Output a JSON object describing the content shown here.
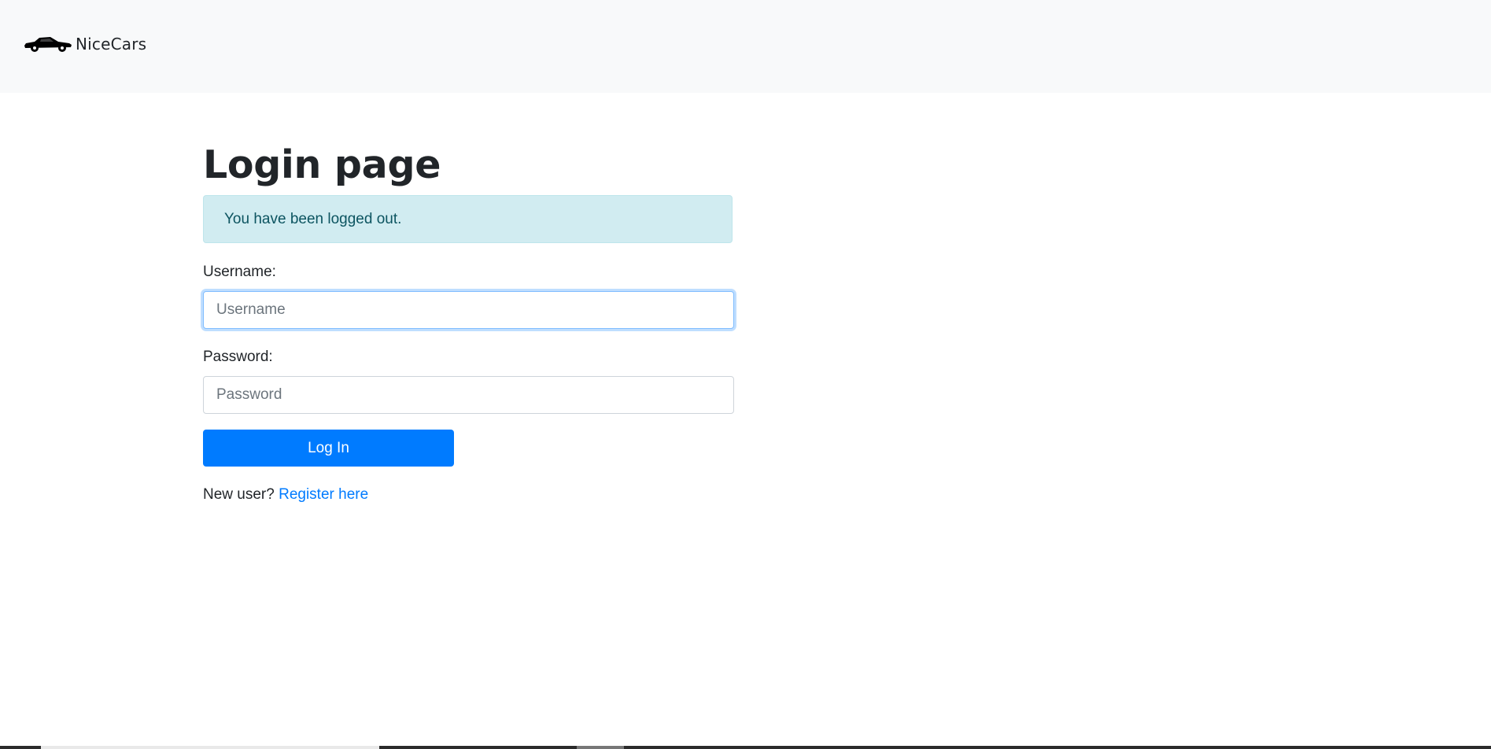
{
  "navbar": {
    "brand_name": "NiceCars",
    "brand_icon": "car-icon"
  },
  "main": {
    "title": "Login page",
    "alert": {
      "message": "You have been logged out.",
      "color": "#d1ecf1"
    },
    "form": {
      "username_label": "Username:",
      "username_placeholder": "Username",
      "username_value": "",
      "password_label": "Password:",
      "password_placeholder": "Password",
      "password_value": "",
      "submit_label": "Log In"
    },
    "register": {
      "prompt": "New user?",
      "link_text": "Register here"
    }
  },
  "colors": {
    "accent": "#007bff",
    "navbar_bg": "#f8f9fa",
    "text": "#212529"
  }
}
